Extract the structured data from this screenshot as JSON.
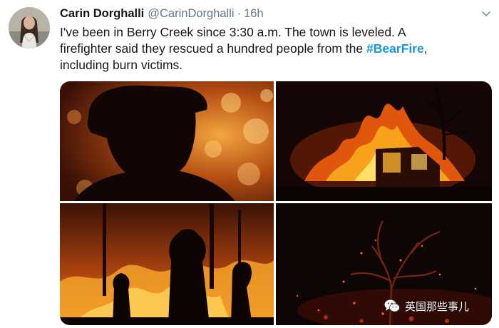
{
  "tweet": {
    "author_name": "Carin Dorghalli",
    "author_handle": "@CarinDorghalli",
    "separator": "·",
    "timestamp": "16h",
    "text_lines": [
      "I've been in Berry Creek since 3:30 a.m. The town is leveled. A",
      "firefighter said they rescued a hundred people from the ",
      "including burn victims."
    ],
    "hashtag": "#BearFire",
    "after_hashtag": ","
  },
  "media": {
    "photos": [
      {
        "icon": "firefighter-silhouette-photo"
      },
      {
        "icon": "burning-house-photo"
      },
      {
        "icon": "firefighters-forest-fire-photo"
      },
      {
        "icon": "burned-tree-embers-photo"
      }
    ]
  },
  "watermark": {
    "text": "英国那些事儿",
    "icon": "wechat-logo-icon"
  },
  "colors": {
    "name": "#14171a",
    "secondary": "#657786",
    "hashtag": "#1b95e0"
  }
}
